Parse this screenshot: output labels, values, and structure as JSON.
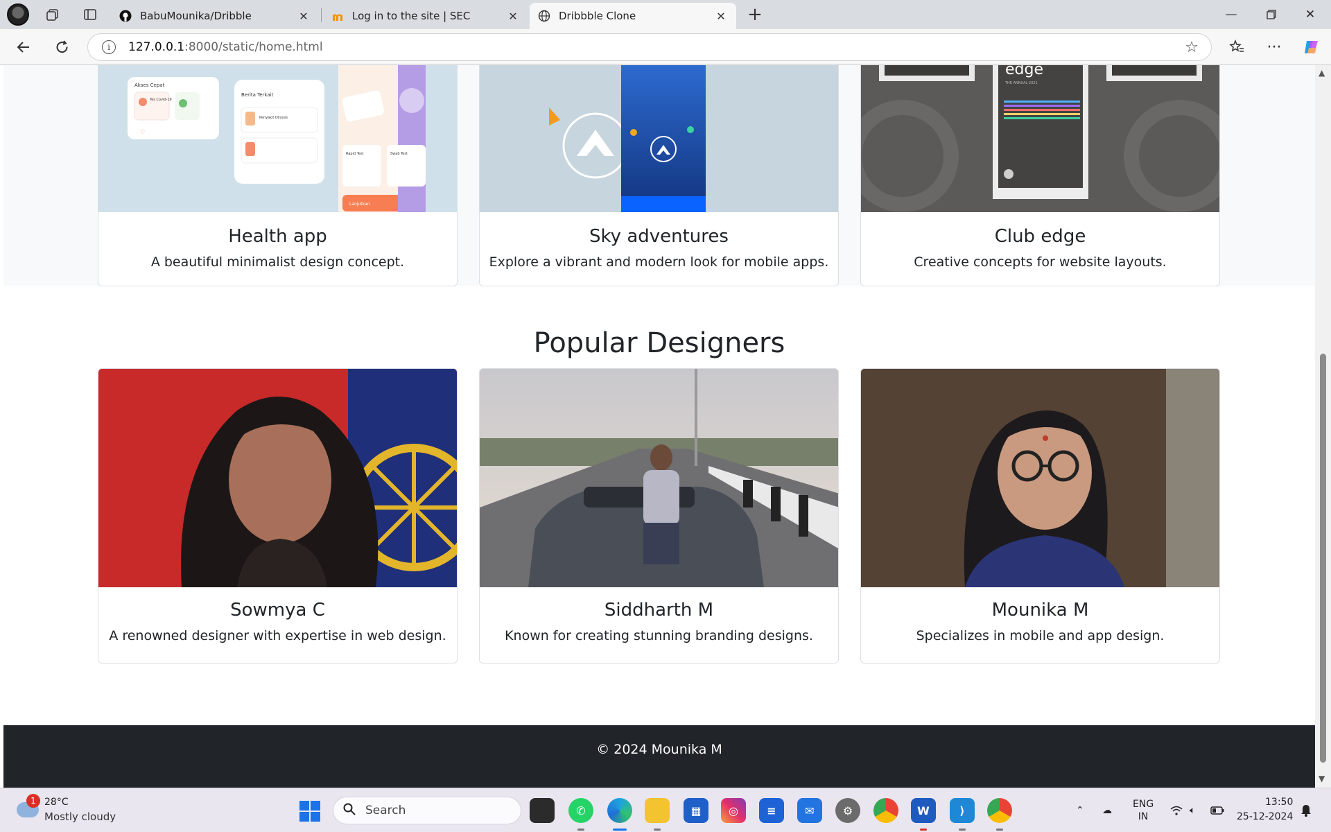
{
  "browser": {
    "tabs": [
      {
        "title": "BabuMounika/Dribble",
        "icon": "github-icon"
      },
      {
        "title": "Log in to the site | SEC",
        "icon": "moodle-icon"
      },
      {
        "title": "Dribbble Clone",
        "icon": "globe-icon"
      }
    ],
    "url_host": "127.0.0.1",
    "url_path": ":8000/static/home.html"
  },
  "shots": [
    {
      "title": "Health app",
      "description": "A beautiful minimalist design concept."
    },
    {
      "title": "Sky adventures",
      "description": "Explore a vibrant and modern look for mobile apps."
    },
    {
      "title": "Club edge",
      "description": "Creative concepts for website layouts."
    }
  ],
  "health_mock": {
    "card1": "Akses Cepat",
    "card1_item": "Tes Covid-19",
    "card2": "Berita Terkait",
    "card2_item": "Penyakit Dinosis",
    "card3": "Rapid Test",
    "card4": "Swab Test",
    "button": "Lanjutkan"
  },
  "club_mock": {
    "logo": "edge",
    "sub": "THE ANNUAL 2021"
  },
  "designers_section": {
    "title": "Popular Designers",
    "designers": [
      {
        "name": "Sowmya C",
        "bio": "A renowned designer with expertise in web design."
      },
      {
        "name": "Siddharth M",
        "bio": "Known for creating stunning branding designs."
      },
      {
        "name": "Mounika M",
        "bio": "Specializes in mobile and app design."
      }
    ]
  },
  "footer": {
    "text": "© 2024 Mounika M"
  },
  "taskbar": {
    "weather_temp": "28°C",
    "weather_cond": "Mostly cloudy",
    "weather_badge": "1",
    "search_label": "Search",
    "lang_top": "ENG",
    "lang_bottom": "IN",
    "time": "13:50",
    "date": "25-12-2024"
  },
  "colors": {
    "page_bg": "#ffffff",
    "section_bg": "#f8f9fa",
    "footer_bg": "#212529",
    "text": "#212529"
  }
}
